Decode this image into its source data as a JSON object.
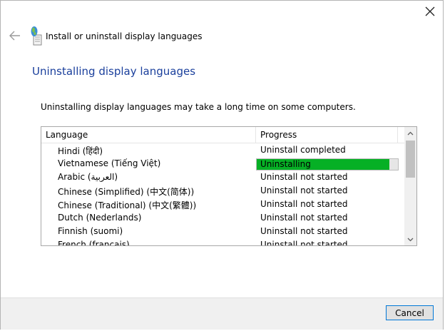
{
  "window": {
    "close_icon": "close-icon"
  },
  "header": {
    "back_icon": "back-arrow-icon",
    "app_icon": "language-globe-icon",
    "title": "Install or uninstall display languages"
  },
  "main": {
    "title": "Uninstalling display languages",
    "description": "Uninstalling display languages may take a long time on some computers."
  },
  "list": {
    "columns": [
      "Language",
      "Progress"
    ],
    "rows": [
      {
        "language": "Hindi (हिंदी)",
        "progress": "Uninstall completed"
      },
      {
        "language": "Vietnamese (Tiếng Việt)",
        "progress": "Uninstalling",
        "progress_value": 0.94
      },
      {
        "language": "Arabic (العربية)",
        "progress": "Uninstall not started"
      },
      {
        "language": "Chinese (Simplified) (中文(简体))",
        "progress": "Uninstall not started"
      },
      {
        "language": "Chinese (Traditional) (中文(繁體))",
        "progress": "Uninstall not started"
      },
      {
        "language": "Dutch (Nederlands)",
        "progress": "Uninstall not started"
      },
      {
        "language": "Finnish (suomi)",
        "progress": "Uninstall not started"
      },
      {
        "language": "French (français)",
        "progress": "Uninstall not started"
      }
    ],
    "scroll_up_icon": "scroll-up-arrow-icon",
    "scroll_down_icon": "scroll-down-arrow-icon",
    "accent_color": "#06b025"
  },
  "footer": {
    "cancel_label": "Cancel"
  }
}
